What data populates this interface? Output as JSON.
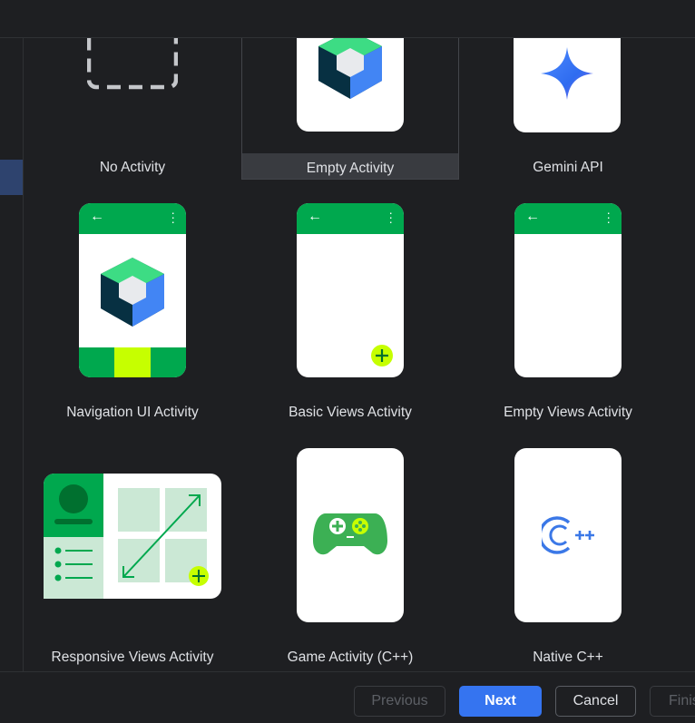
{
  "templates": [
    {
      "label": "No Activity",
      "selected": false,
      "icon": "dashed-square-icon"
    },
    {
      "label": "Empty Activity",
      "selected": true,
      "icon": "compose-cube-icon"
    },
    {
      "label": "Gemini API",
      "selected": false,
      "icon": "gemini-sparkle-icon"
    },
    {
      "label": "Navigation UI Activity",
      "selected": false,
      "icon": "navigation-phone-icon"
    },
    {
      "label": "Basic Views Activity",
      "selected": false,
      "icon": "basic-views-phone-icon"
    },
    {
      "label": "Empty Views Activity",
      "selected": false,
      "icon": "empty-views-phone-icon"
    },
    {
      "label": "Responsive Views Activity",
      "selected": false,
      "icon": "responsive-views-icon"
    },
    {
      "label": "Game Activity (C++)",
      "selected": false,
      "icon": "gamepad-icon"
    },
    {
      "label": "Native C++",
      "selected": false,
      "icon": "cpp-logo-icon"
    }
  ],
  "footer": {
    "previous": "Previous",
    "next": "Next",
    "cancel": "Cancel",
    "finish": "Finish"
  },
  "colors": {
    "background": "#1e1f22",
    "accent": "#3574f0",
    "green": "#00a84e",
    "lime": "#c6ff00"
  }
}
